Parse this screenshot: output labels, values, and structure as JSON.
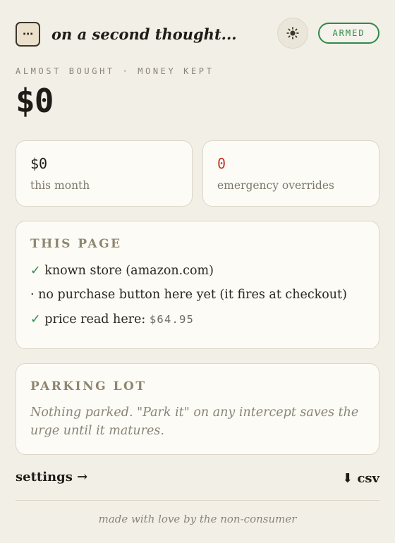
{
  "header": {
    "menu_glyph": "⋯",
    "title": "on a second thought...",
    "status": "ARMED"
  },
  "summary": {
    "eyebrow": "ALMOST BOUGHT · MONEY KEPT",
    "total": "$0"
  },
  "stats": [
    {
      "value": "$0",
      "label": "this month",
      "value_color": "#1f1c17"
    },
    {
      "value": "0",
      "label": "emergency overrides",
      "value_color": "#c0392b"
    }
  ],
  "this_page": {
    "heading": "THIS PAGE",
    "lines": [
      {
        "mark": "✓",
        "text": "known store (amazon.com)"
      },
      {
        "mark": "·",
        "text": "no purchase button here yet (it fires at checkout)"
      },
      {
        "mark": "✓",
        "text": "price read here: ",
        "price": "$64.95"
      }
    ]
  },
  "parking_lot": {
    "heading": "PARKING LOT",
    "empty_text": "Nothing parked. \"Park it\" on any intercept saves the urge until it matures."
  },
  "footer_links": {
    "settings": "settings →",
    "csv": "⬇ csv"
  },
  "footer": "made with love by the non-consumer",
  "colors": {
    "accent_green": "#2f8a4a",
    "override_red": "#c0392b",
    "background": "#f2efe7"
  },
  "icons": {
    "menu": "ellipsis-icon",
    "theme": "sun-icon",
    "download": "download-icon"
  }
}
